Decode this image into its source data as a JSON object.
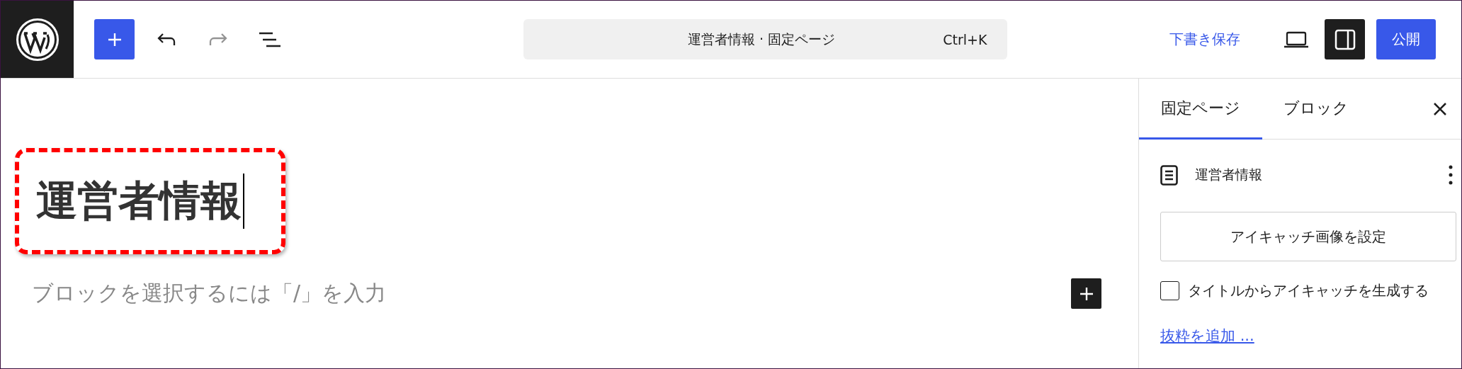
{
  "toolbar": {
    "tools": [
      {
        "kind": "add",
        "disabled": false
      },
      {
        "kind": "undo",
        "disabled": false
      },
      {
        "kind": "redo",
        "disabled": true
      },
      {
        "kind": "outline",
        "disabled": false
      }
    ]
  },
  "command_bar": {
    "title": "運営者情報 · 固定ページ",
    "shortcut": "Ctrl+K"
  },
  "save_draft": "下書き保存",
  "settings_toggle": {
    "selected": true
  },
  "publish": "公開",
  "editor": {
    "title": "運営者情報",
    "highlighted": true,
    "appender_hint": "ブロックを選択するには「/」を入力"
  },
  "sidebar": {
    "tabs": [
      {
        "label": "固定ページ",
        "selected": true
      },
      {
        "label": "ブロック",
        "selected": false
      }
    ],
    "page_title": "運営者情報",
    "featured_image_button": "アイキャッチ画像を設定",
    "generate_checkbox": {
      "label": "タイトルからアイキャッチを生成する",
      "checked": false
    },
    "excerpt_link": "抜粋を追加 ..."
  }
}
